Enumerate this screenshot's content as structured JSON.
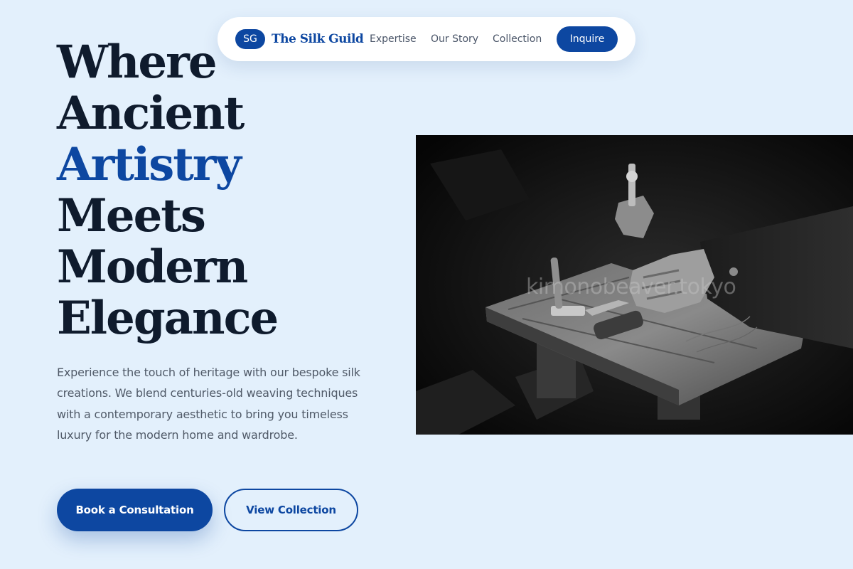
{
  "nav": {
    "badge": "SG",
    "brand": "The Silk Guild",
    "links": [
      "Expertise",
      "Our Story",
      "Collection"
    ],
    "cta": "Inquire"
  },
  "hero": {
    "headline": [
      "Where",
      "Ancient",
      "Artistry",
      "Meets",
      "Modern",
      "Elegance"
    ],
    "intro": "Experience the touch of heritage with our bespoke silk creations. We blend centuries-old weaving techniques with a contemporary aesthetic to bring you timeless luxury for the modern home and wardrobe.",
    "primary_cta": "Book a Consultation",
    "secondary_cta": "View Collection",
    "image_watermark": "kimonobeaver.tokyo"
  },
  "colors": {
    "background": "#e3f0fc",
    "accent": "#0d47a1",
    "heading": "#0f1b2d",
    "body_text": "#505a68"
  },
  "icons": {
    "brand_badge": "monogram-badge"
  }
}
